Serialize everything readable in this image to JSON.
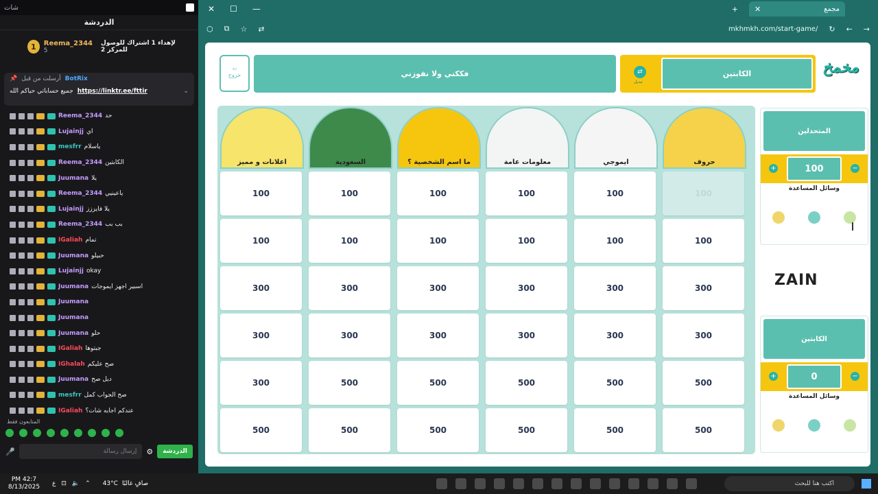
{
  "chat": {
    "topbar_title": "شات",
    "header": "الدردشة",
    "leader": {
      "rank": "1",
      "username": "Reema_2344",
      "sub_count": "5",
      "goal_text": "لإهداء 1 اشتراك للوصول للمركز 2"
    },
    "pinned": {
      "pinned_by": "أرسلت من قبل",
      "bot": "BotRix",
      "message": "جميع حساباتي حياكم الله",
      "link": "https://linktr.ee/fttir"
    },
    "messages": [
      {
        "user": "Reema_2344",
        "text": "حد",
        "color": "#c59cff"
      },
      {
        "user": "Lujainjj",
        "text": "اي",
        "color": "#c59cff"
      },
      {
        "user": "mesfrr",
        "text": "ياسلام",
        "color": "#3ec8c4"
      },
      {
        "user": "Reema_2344",
        "text": "الكابتين",
        "color": "#c59cff"
      },
      {
        "user": "Juumana",
        "text": "يلا",
        "color": "#c59cff"
      },
      {
        "user": "Reema_2344",
        "text": "ياعينيي",
        "color": "#c59cff"
      },
      {
        "user": "Lujainjj",
        "text": "يلا فايززز",
        "color": "#c59cff"
      },
      {
        "user": "Reema_2344",
        "text": "بب بب",
        "color": "#c59cff"
      },
      {
        "user": "IGaliah",
        "text": "تمام",
        "color": "#ff4a5c"
      },
      {
        "user": "Juumana",
        "text": "حبيلو",
        "color": "#c59cff"
      },
      {
        "user": "Lujainjj",
        "text": "okay",
        "color": "#c59cff"
      },
      {
        "user": "Juumana",
        "text": "اسبير اجهز ايموجات",
        "color": "#c59cff"
      },
      {
        "user": "Juumana",
        "text": "",
        "color": "#c59cff"
      },
      {
        "user": "Juumana",
        "text": "",
        "color": "#c59cff"
      },
      {
        "user": "Juumana",
        "text": "حلو",
        "color": "#c59cff"
      },
      {
        "user": "IGaliah",
        "text": "جبتوها",
        "color": "#ff4a5c"
      },
      {
        "user": "IGhalah",
        "text": "صح عليكم",
        "color": "#ff4a5c"
      },
      {
        "user": "Juumana",
        "text": "ديل صح",
        "color": "#c59cff"
      },
      {
        "user": "mesfrr",
        "text": "صح الجواب كمل",
        "color": "#3ec8c4"
      },
      {
        "user": "IGaliah",
        "text": "عندكم اجابه شات؟",
        "color": "#ff4a5c"
      },
      {
        "user": "Reema_2344",
        "text": "لا",
        "color": "#c59cff"
      }
    ],
    "followers_only": "المتابعون فقط",
    "input_placeholder": "إرسال رسالة",
    "chat_button": "الدردشة"
  },
  "browser": {
    "tab_title": "مجمع",
    "url": "mkhmkh.com/start-game/"
  },
  "game": {
    "exit_label": "خروج",
    "team2_title": "فككني ولا نفوزني",
    "team1_title": "الكابتين",
    "swap_label": "تبديل",
    "logo": "مخمخ",
    "categories": [
      {
        "label": "اعلانات و مميز",
        "color": "#f7e46a"
      },
      {
        "label": "السعودية",
        "color": "#3e8a4a"
      },
      {
        "label": "ما اسم الشخصية ؟",
        "color": "#f6c60f"
      },
      {
        "label": "معلومات عامة",
        "color": "#f2f5f4"
      },
      {
        "label": "ايموجي",
        "color": "#f5f5f5"
      },
      {
        "label": "حروف",
        "color": "#f5d24a"
      }
    ],
    "rows": [
      [
        "100",
        "100",
        "100",
        "100",
        "100",
        "100"
      ],
      [
        "100",
        "100",
        "100",
        "100",
        "100",
        "100"
      ],
      [
        "300",
        "300",
        "300",
        "300",
        "300",
        "300"
      ],
      [
        "300",
        "300",
        "300",
        "300",
        "300",
        "300"
      ],
      [
        "300",
        "500",
        "500",
        "500",
        "500",
        "500"
      ],
      [
        "500",
        "500",
        "500",
        "500",
        "500",
        "500"
      ]
    ],
    "used_cells": [
      [
        0,
        5
      ]
    ],
    "side_teams": [
      {
        "name": "المتحدلين",
        "score": "100",
        "help": "وسائل المساعدة"
      },
      {
        "name": "الكابتين",
        "score": "0",
        "help": "وسائل المساعدة"
      }
    ],
    "sponsor": "ZAIN",
    "plus": "+",
    "minus": "−"
  },
  "taskbar": {
    "time": "PM 42:7",
    "date": "8/13/2025",
    "temp": "43°C",
    "weather": "صافٍ غالبًا",
    "lang": "ع",
    "search": "اكتب هنا للبحث"
  }
}
